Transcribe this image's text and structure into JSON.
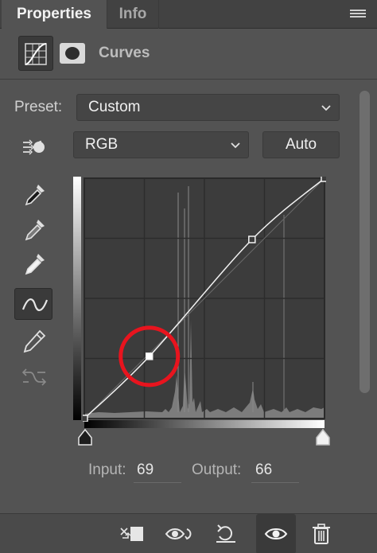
{
  "tabs": [
    {
      "label": "Properties",
      "active": true
    },
    {
      "label": "Info",
      "active": false
    }
  ],
  "header": {
    "title": "Curves",
    "icons": [
      "curves-adjustment-icon",
      "layer-mask-icon"
    ]
  },
  "preset": {
    "label": "Preset:",
    "value": "Custom"
  },
  "channel": {
    "value": "RGB"
  },
  "auto_label": "Auto",
  "tools": [
    "on-image-adjust-icon",
    "black-point-eyedropper-icon",
    "gray-point-eyedropper-icon",
    "white-point-eyedropper-icon",
    "curve-edit-icon",
    "pencil-draw-icon",
    "smooth-curve-icon"
  ],
  "curve": {
    "points": [
      [
        0,
        0
      ],
      [
        69,
        66
      ],
      [
        178,
        190
      ],
      [
        255,
        255
      ]
    ],
    "selected_point_index": 1,
    "highlight_color": "#e8141e"
  },
  "io": {
    "input_label": "Input:",
    "input_value": "69",
    "output_label": "Output:",
    "output_value": "66"
  },
  "footer_icons": [
    "clip-to-layer-icon",
    "view-previous-state-icon",
    "reset-icon",
    "toggle-visibility-icon",
    "delete-icon"
  ],
  "colors": {
    "panel_bg": "#535353",
    "graph_bg": "#3c3c3c"
  }
}
